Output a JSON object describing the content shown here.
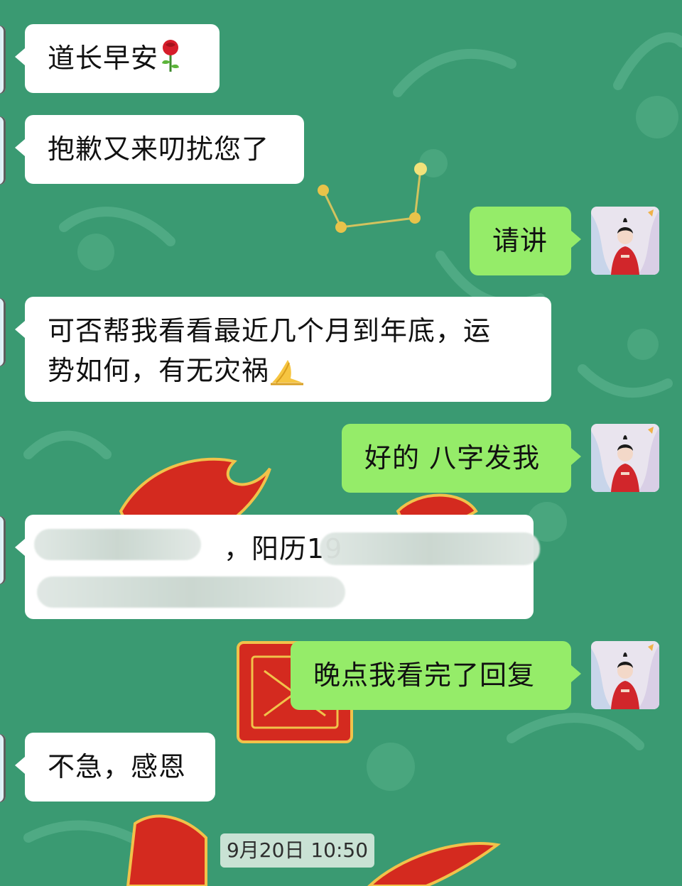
{
  "colors": {
    "background": "#3a9a72",
    "incoming_bubble": "#ffffff",
    "outgoing_bubble": "#95ec69",
    "timestamp_bg": "#d6e8dc"
  },
  "messages": [
    {
      "side": "incoming",
      "text": "道长早安",
      "emoji": "rose-icon"
    },
    {
      "side": "incoming",
      "text": "抱歉又来叨扰您了"
    },
    {
      "side": "outgoing",
      "text": "请讲"
    },
    {
      "side": "incoming",
      "line1": "可否帮我看看最近几个月到年底，运",
      "line2": "势如何，有无灾祸",
      "emoji": "pray-icon"
    },
    {
      "side": "outgoing",
      "text": "好的 八字发我"
    },
    {
      "side": "incoming",
      "visible_text": "，阳历19",
      "redacted": true
    },
    {
      "side": "outgoing",
      "text": "晚点我看完了回复"
    },
    {
      "side": "incoming",
      "text": "不急，感恩"
    }
  ],
  "timestamp": "9月20日 10:50"
}
